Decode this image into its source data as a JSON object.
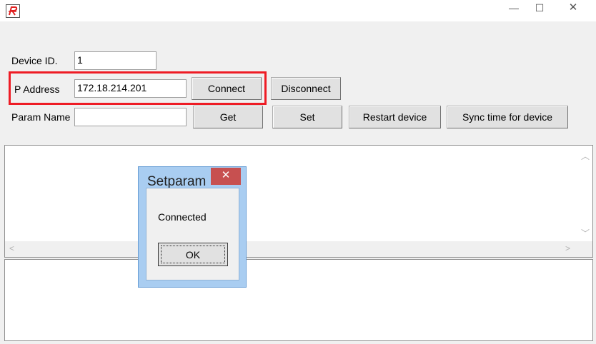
{
  "window": {
    "icon": "app-logo-icon",
    "controls": {
      "minimize": "—",
      "maximize": "☐",
      "close": "✕"
    }
  },
  "form": {
    "device_id_label": "Device ID.",
    "device_id_value": "1",
    "ip_label": "P Address",
    "ip_value": "172.18.214.201",
    "param_label": "Param Name",
    "param_value": ""
  },
  "buttons": {
    "connect": "Connect",
    "disconnect": "Disconnect",
    "get": "Get",
    "set": "Set",
    "restart": "Restart device",
    "sync": "Sync time for device"
  },
  "dialog": {
    "title": "Setparam",
    "close": "✕",
    "message": "Connected",
    "ok": "OK"
  },
  "colors": {
    "highlight": "#ee1c25",
    "dialog_frame": "#a9cdf1",
    "dialog_close": "#c75050"
  }
}
